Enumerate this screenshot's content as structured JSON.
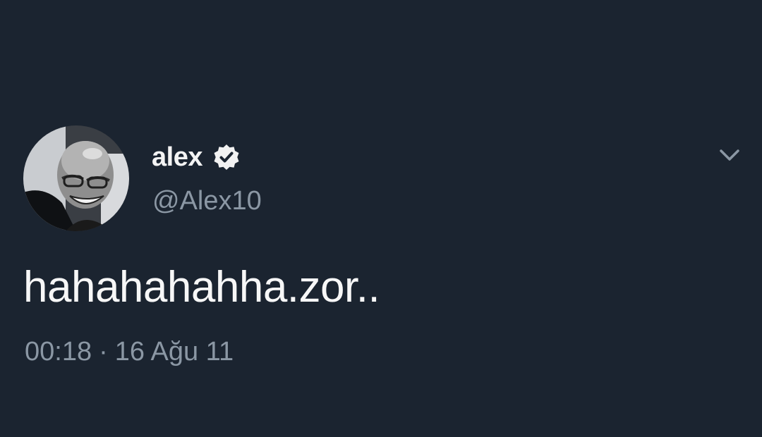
{
  "tweet": {
    "display_name": "alex",
    "handle": "@Alex10",
    "verified": true,
    "text": "hahahahahha.zor..",
    "time": "00:18",
    "separator": "·",
    "date": "16 Ağu 11"
  },
  "icons": {
    "verified": "verified-badge-icon",
    "menu": "chevron-down-icon"
  },
  "colors": {
    "background": "#1b2430",
    "name": "#f4f4f4",
    "secondary": "#8b97a4"
  }
}
